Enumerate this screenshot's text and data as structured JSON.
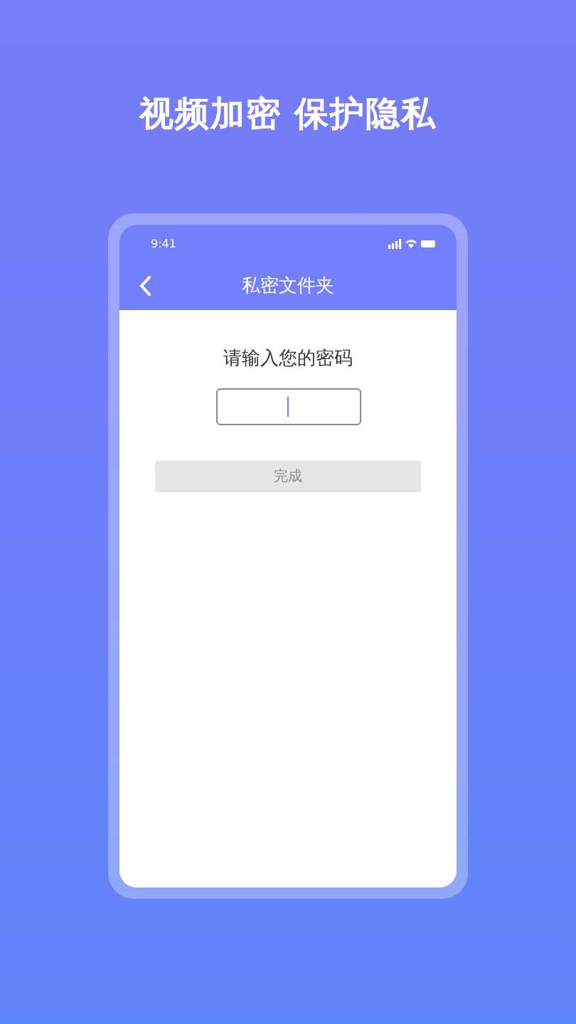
{
  "headline": "视频加密 保护隐私",
  "status_bar": {
    "time": "9:41"
  },
  "nav_bar": {
    "title": "私密文件夹"
  },
  "prompt": "请输入您的密码",
  "password_field": {
    "focused": true
  },
  "done_button": {
    "label": "完成",
    "disabled": true
  }
}
